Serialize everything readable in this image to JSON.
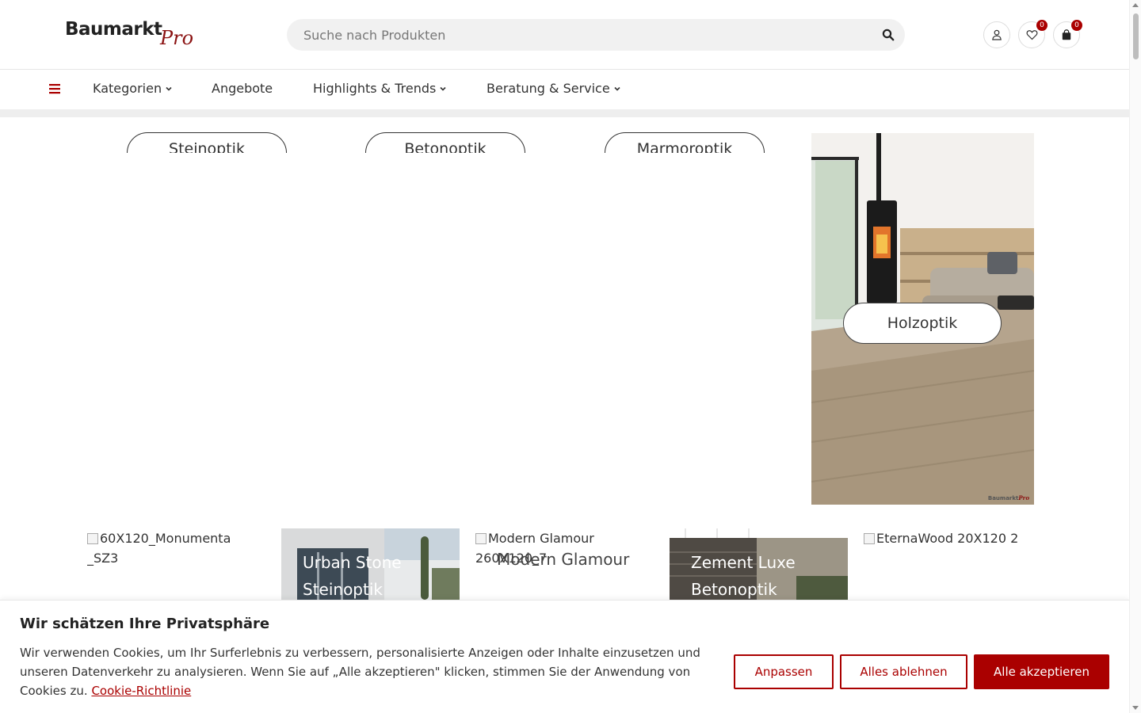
{
  "header": {
    "logo_main": "Baumarkt",
    "logo_sub": "Pro",
    "search_placeholder": "Suche nach Produkten",
    "wishlist_count": "0",
    "cart_count": "0"
  },
  "nav": {
    "items": [
      {
        "label": "Kategorien",
        "dropdown": true
      },
      {
        "label": "Angebote",
        "dropdown": false
      },
      {
        "label": "Highlights & Trends",
        "dropdown": true
      },
      {
        "label": "Beratung & Service",
        "dropdown": true
      }
    ]
  },
  "categories": [
    {
      "label": "Steinoptik"
    },
    {
      "label": "Betonoptik"
    },
    {
      "label": "Marmoroptik"
    },
    {
      "label": "Holzoptik"
    }
  ],
  "holz_watermark": {
    "main": "Baumarkt",
    "sub": "Pro"
  },
  "products": [
    {
      "alt": "60X120_Monumenta _SZ3",
      "title": ""
    },
    {
      "alt": "",
      "title_line1": "Urban Stone",
      "title_line2": "Steinoptik"
    },
    {
      "alt": "Modern Glamour 260X120_7",
      "title_line1": "Modern Glamour"
    },
    {
      "alt": "",
      "title_line1": "Zement Luxe",
      "title_line2": "Betonoptik"
    },
    {
      "alt": "EternaWood 20X120 2",
      "title": ""
    }
  ],
  "cookie": {
    "title": "Wir schätzen Ihre Privatsphäre",
    "text": "Wir verwenden Cookies, um Ihr Surferlebnis zu verbessern, personalisierte Anzeigen oder Inhalte einzusetzen und unseren Datenverkehr zu analysieren. Wenn Sie auf „Alle akzeptieren\" klicken, stimmen Sie der Anwendung von Cookies zu.",
    "link": "Cookie-Richtlinie",
    "btn_customize": "Anpassen",
    "btn_reject": "Alles ablehnen",
    "btn_accept": "Alle akzeptieren"
  },
  "colors": {
    "accent": "#aa0000",
    "logo_pro": "#8b1212"
  }
}
